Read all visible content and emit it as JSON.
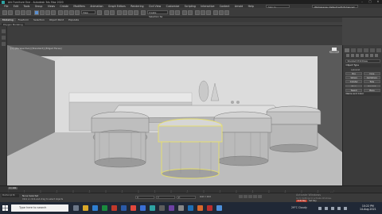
{
  "window": {
    "title": "Ark Furniture One - Autodesk 3ds Max 2020"
  },
  "menu": {
    "items": [
      "File",
      "Edit",
      "Tools",
      "Group",
      "Views",
      "Create",
      "Modifiers",
      "Animation",
      "Graph Editors",
      "Rendering",
      "Civil View",
      "Customize",
      "Scripting",
      "Interactive",
      "Content",
      "Arnold",
      "Help"
    ],
    "search_placeholder": "Sign In",
    "workspace": "Workspaces: Default with Enhanced Menus"
  },
  "toolbar": {
    "view_dropdown": "View",
    "selection_set": "Create Selection Se"
  },
  "ribbon": {
    "tabs": [
      "Modeling",
      "Freeform",
      "Selection",
      "Object Paint",
      "Populate"
    ],
    "active_tab": "Modeling",
    "sub_label": "Polygon Modeling"
  },
  "viewport": {
    "label": "[+] [Perspective] [Standard] [Edged Faces]"
  },
  "command_panel": {
    "category": "Standard Primitives",
    "object_type_header": "Object Type",
    "autogrid": "AutoGrid",
    "buttons": [
      "Box",
      "Cone",
      "Sphere",
      "GeoSphere",
      "Cylinder",
      "Tube",
      "Torus",
      "Pyramid",
      "Teapot",
      "Plane",
      "TextPlus",
      ""
    ],
    "name_color_header": "Name and Color"
  },
  "timeline": {
    "frame_label": "0 / 100",
    "ticks": [
      "0",
      "5",
      "10",
      "15",
      "20",
      "25",
      "30",
      "35",
      "40",
      "45",
      "50",
      "55",
      "60",
      "65",
      "70",
      "75",
      "80",
      "85",
      "90",
      "95",
      "100"
    ]
  },
  "status": {
    "maxscript": "MAXScript Mi",
    "selection": "None Selected",
    "hint": "Click or click-and-drag to select objects",
    "x_label": "X:",
    "y_label": "Y:",
    "z_label": "Z:",
    "grid": "Grid = 10.0",
    "activate_title": "Activate Windows",
    "activate_sub": "Go to Settings to activate Windows.",
    "auto_key": "Auto Key",
    "set_key": "Set Key"
  },
  "taskbar": {
    "search_placeholder": "Type here to search",
    "weather": "29°C  Cloudy",
    "time": "10:22 PM",
    "date": "14-Aug-2021",
    "accent": "#202836"
  }
}
